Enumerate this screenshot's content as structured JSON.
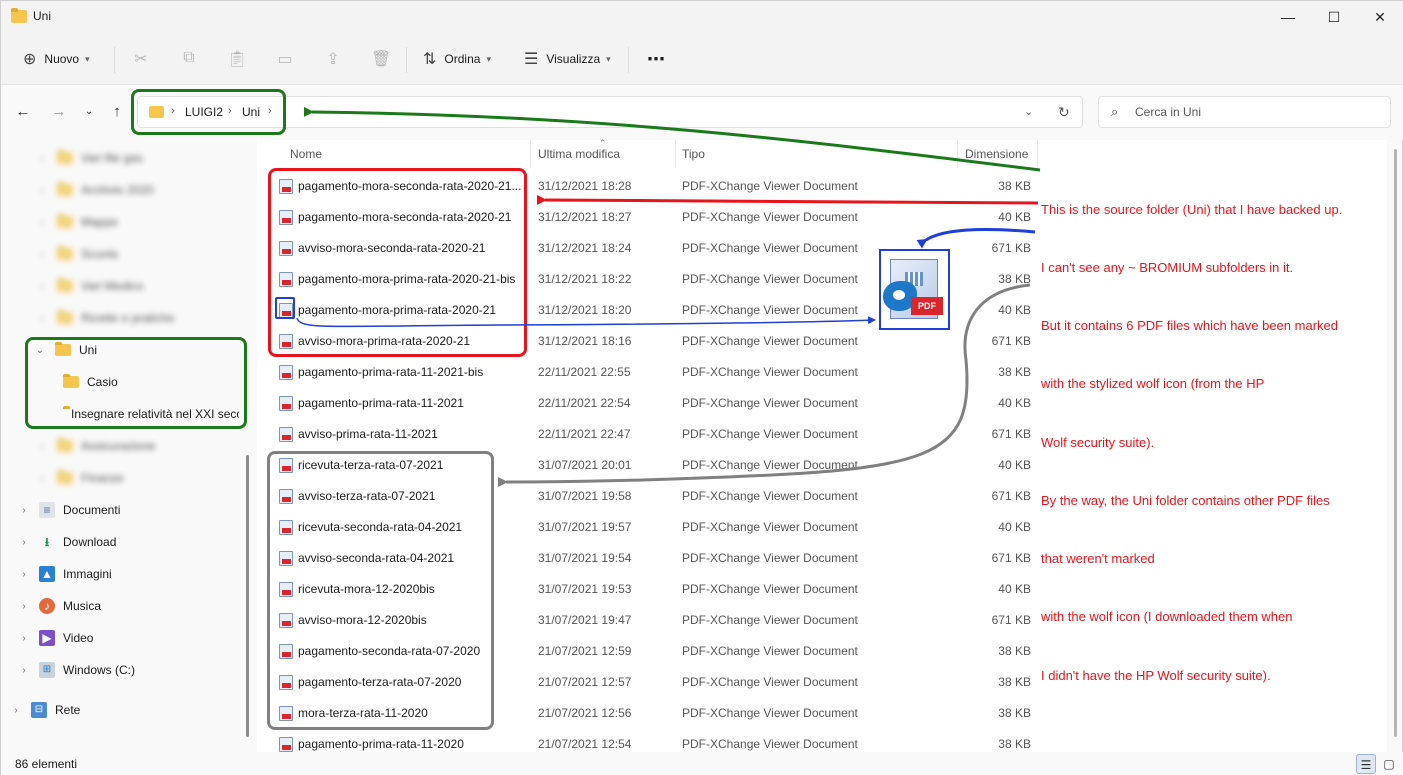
{
  "window": {
    "title": "Uni",
    "minimize_glyph": "—",
    "maximize_glyph": "☐",
    "close_glyph": "✕"
  },
  "commandbar": {
    "new_label": "Nuovo",
    "sort_label": "Ordina",
    "view_label": "Visualizza",
    "more_glyph": "⋯"
  },
  "address": {
    "crumbs": [
      "LUIGI2",
      "Uni"
    ],
    "separator": "›"
  },
  "search": {
    "placeholder": "Cerca in Uni"
  },
  "navpane": {
    "blurred_items": [
      "Vari file gas",
      "Archivio 2020",
      "Mappe",
      "Scuola",
      "Vari Medico",
      "Ricette e pratiche"
    ],
    "uni_label": "Uni",
    "uni_children": [
      "Casio",
      "Insegnare relatività nel XXI secolo"
    ],
    "blurred_after": [
      "Assicurazione",
      "Finanze"
    ],
    "system_items": [
      "Documenti",
      "Download",
      "Immagini",
      "Musica",
      "Video",
      "Windows  (C:)"
    ],
    "network_label": "Rete"
  },
  "columns": {
    "name": "Nome",
    "modified": "Ultima modifica",
    "type": "Tipo",
    "size": "Dimensione"
  },
  "files": [
    {
      "name": "pagamento-mora-seconda-rata-2020-21...",
      "date": "31/12/2021 18:28",
      "type": "PDF-XChange Viewer Document",
      "size": "38 KB"
    },
    {
      "name": "pagamento-mora-seconda-rata-2020-21",
      "date": "31/12/2021 18:27",
      "type": "PDF-XChange Viewer Document",
      "size": "40 KB"
    },
    {
      "name": "avviso-mora-seconda-rata-2020-21",
      "date": "31/12/2021 18:24",
      "type": "PDF-XChange Viewer Document",
      "size": "671 KB"
    },
    {
      "name": "pagamento-mora-prima-rata-2020-21-bis",
      "date": "31/12/2021 18:22",
      "type": "PDF-XChange Viewer Document",
      "size": "38 KB"
    },
    {
      "name": "pagamento-mora-prima-rata-2020-21",
      "date": "31/12/2021 18:20",
      "type": "PDF-XChange Viewer Document",
      "size": "40 KB"
    },
    {
      "name": "avviso-mora-prima-rata-2020-21",
      "date": "31/12/2021 18:16",
      "type": "PDF-XChange Viewer Document",
      "size": "671 KB"
    },
    {
      "name": "pagamento-prima-rata-11-2021-bis",
      "date": "22/11/2021 22:55",
      "type": "PDF-XChange Viewer Document",
      "size": "38 KB"
    },
    {
      "name": "pagamento-prima-rata-11-2021",
      "date": "22/11/2021 22:54",
      "type": "PDF-XChange Viewer Document",
      "size": "40 KB"
    },
    {
      "name": "avviso-prima-rata-11-2021",
      "date": "22/11/2021 22:47",
      "type": "PDF-XChange Viewer Document",
      "size": "671 KB"
    },
    {
      "name": "ricevuta-terza-rata-07-2021",
      "date": "31/07/2021 20:01",
      "type": "PDF-XChange Viewer Document",
      "size": "40 KB"
    },
    {
      "name": "avviso-terza-rata-07-2021",
      "date": "31/07/2021 19:58",
      "type": "PDF-XChange Viewer Document",
      "size": "671 KB"
    },
    {
      "name": "ricevuta-seconda-rata-04-2021",
      "date": "31/07/2021 19:57",
      "type": "PDF-XChange Viewer Document",
      "size": "40 KB"
    },
    {
      "name": "avviso-seconda-rata-04-2021",
      "date": "31/07/2021 19:54",
      "type": "PDF-XChange Viewer Document",
      "size": "671 KB"
    },
    {
      "name": "ricevuta-mora-12-2020bis",
      "date": "31/07/2021 19:53",
      "type": "PDF-XChange Viewer Document",
      "size": "40 KB"
    },
    {
      "name": "avviso-mora-12-2020bis",
      "date": "31/07/2021 19:47",
      "type": "PDF-XChange Viewer Document",
      "size": "671 KB"
    },
    {
      "name": "pagamento-seconda-rata-07-2020",
      "date": "21/07/2021 12:59",
      "type": "PDF-XChange Viewer Document",
      "size": "38 KB"
    },
    {
      "name": "pagamento-terza-rata-07-2020",
      "date": "21/07/2021 12:57",
      "type": "PDF-XChange Viewer Document",
      "size": "38 KB"
    },
    {
      "name": "mora-terza-rata-11-2020",
      "date": "21/07/2021 12:56",
      "type": "PDF-XChange Viewer Document",
      "size": "38 KB"
    },
    {
      "name": "pagamento-prima-rata-11-2020",
      "date": "21/07/2021 12:54",
      "type": "PDF-XChange Viewer Document",
      "size": "38 KB"
    }
  ],
  "status": {
    "item_count": "86 elementi"
  },
  "annotation": {
    "lines": [
      "This is the source folder (Uni) that I have backed up.",
      "I can't see any ~ BROMIUM subfolders in it.",
      "But it contains 6 PDF files which have been marked",
      "with the stylized wolf icon (from the HP",
      "Wolf security suite).",
      "By the way, the Uni folder contains other PDF files",
      "that weren't marked",
      "with the wolf icon (I downloaded them when",
      "I didn't have the HP Wolf security suite)."
    ],
    "wolf_icon_label": "PDF"
  },
  "colors": {
    "green_box": "#1a7a1a",
    "red_box": "#e8141c",
    "blue_box": "#1f3fd8",
    "gray_box": "#808080",
    "folder": "#f4c64e"
  },
  "icons": {
    "new": "plus-circle-icon",
    "cut": "scissors-icon",
    "copy": "copy-icon",
    "paste": "clipboard-icon",
    "rename": "rename-icon",
    "share": "share-icon",
    "delete": "trash-icon",
    "sort": "sort-arrows-icon",
    "view": "view-lines-icon"
  }
}
